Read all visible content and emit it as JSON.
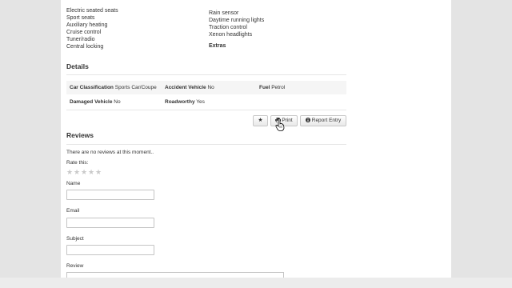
{
  "features": {
    "left": [
      "Electric seated seats",
      "Sport seats",
      "Auxiliary heating",
      "Cruise control",
      "Tuner/radio",
      "Central locking"
    ],
    "right": [
      "Rain sensor",
      "Daytime running lights",
      "Traction control",
      "Xenon headlights"
    ],
    "extras_heading": "Extras"
  },
  "details": {
    "heading": "Details",
    "row1": {
      "car_classification_label": "Car Classification",
      "car_classification_value": "Sports Car/Coupe",
      "accident_vehicle_label": "Accident Vehicle",
      "accident_vehicle_value": "No",
      "fuel_label": "Fuel",
      "fuel_value": "Petrol"
    },
    "row2": {
      "damaged_vehicle_label": "Damaged Vehicle",
      "damaged_vehicle_value": "No",
      "roadworthy_label": "Roadworthy",
      "roadworthy_value": "Yes"
    }
  },
  "actions": {
    "favorite_icon": "star-icon",
    "print_label": "Print",
    "print_icon": "printer-icon",
    "report_label": "Report Entry",
    "report_icon": "info-icon"
  },
  "reviews": {
    "heading": "Reviews",
    "empty_message": "There are no reviews at this moment..",
    "rate_label": "Rate this:",
    "rating_stars": 5,
    "rating_value": 0,
    "fields": {
      "name_label": "Name",
      "email_label": "Email",
      "subject_label": "Subject",
      "review_label": "Review"
    }
  },
  "colors": {
    "page_bg": "#e4e4e4",
    "card_bg": "#ffffff",
    "row_shade": "#f5f5f5",
    "star_empty": "#c9c9c9"
  }
}
